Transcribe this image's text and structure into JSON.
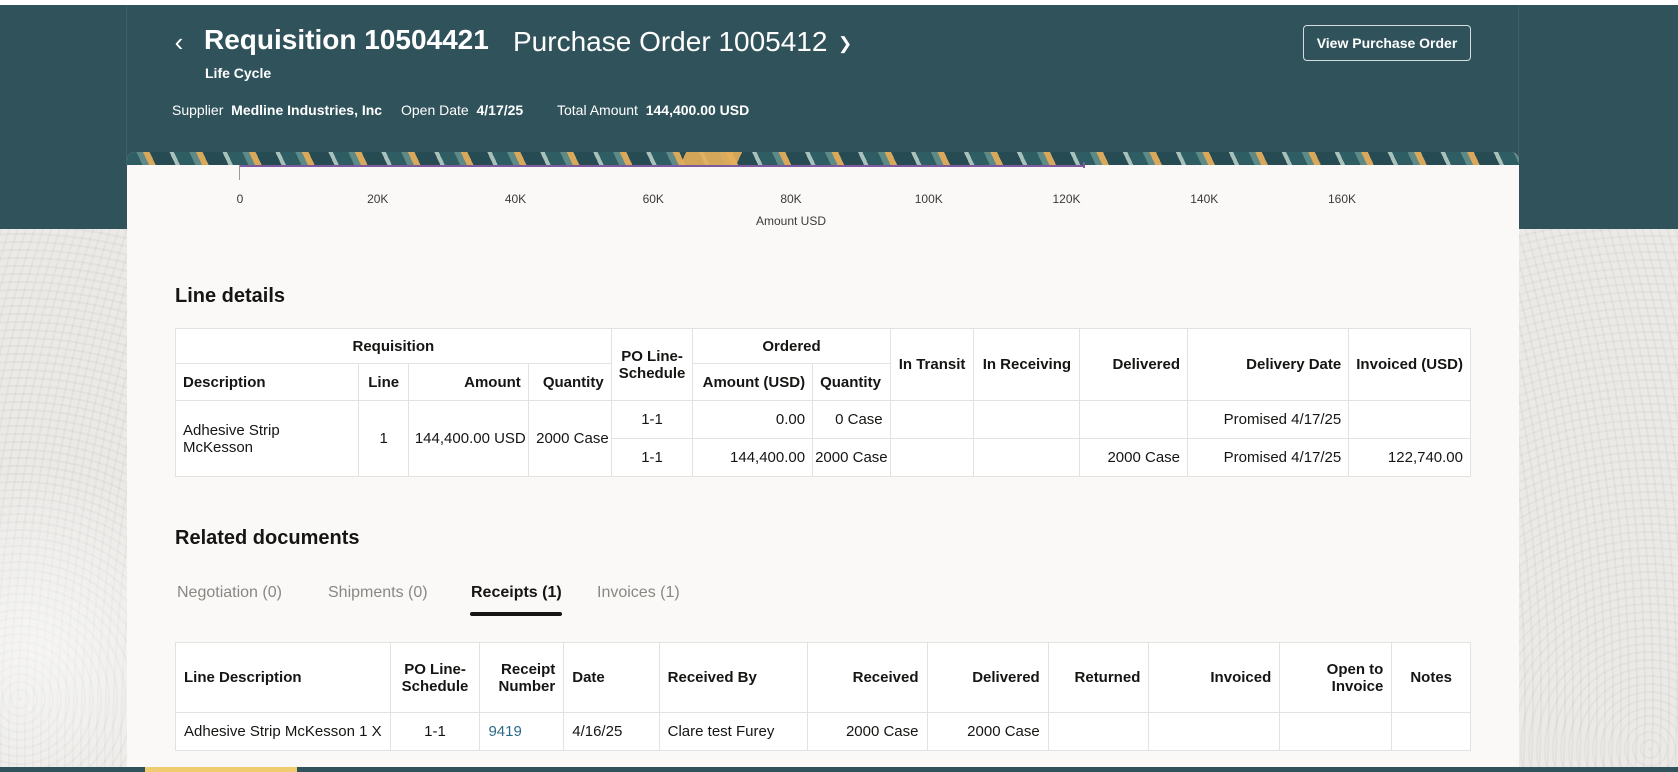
{
  "header": {
    "back_icon": "chevron-left-icon",
    "title": "Requisition 10504421",
    "subtitle": "Purchase Order 1005412",
    "dropdown_icon": "chevron-down-icon",
    "lifecycle": "Life Cycle",
    "supplier_label": "Supplier",
    "supplier_value": "Medline Industries, Inc",
    "open_date_label": "Open Date",
    "open_date_value": "4/17/25",
    "total_amount_label": "Total Amount",
    "total_amount_value": "144,400.00 USD",
    "view_po_button": "View Purchase Order"
  },
  "chart_data": {
    "type": "bar",
    "orientation": "horizontal",
    "xlabel": "Amount USD",
    "tick_labels": [
      "0",
      "20K",
      "40K",
      "60K",
      "80K",
      "100K",
      "120K",
      "140K",
      "160K"
    ],
    "xlim": [
      0,
      160000
    ],
    "series": [
      {
        "values": [
          122740
        ]
      }
    ]
  },
  "line_details": {
    "title": "Line details",
    "group_headers": {
      "requisition": "Requisition",
      "po_line_schedule": "PO Line-Schedule",
      "ordered": "Ordered",
      "in_transit": "In Transit",
      "in_receiving": "In Receiving",
      "delivered": "Delivered",
      "delivery_date": "Delivery Date",
      "invoiced": "Invoiced (USD)"
    },
    "sub_headers": {
      "description": "Description",
      "line": "Line",
      "amount": "Amount",
      "quantity": "Quantity",
      "amount_usd": "Amount (USD)",
      "ordered_quantity": "Quantity"
    },
    "req": {
      "description": "Adhesive Strip McKesson",
      "line": "1",
      "amount": "144,400.00 USD",
      "quantity": "2000 Case"
    },
    "rows": [
      {
        "po_line_schedule": "1-1",
        "amount_usd": "0.00",
        "quantity": "0 Case",
        "in_transit": "",
        "in_receiving": "",
        "delivered": "",
        "delivery_date": "Promised 4/17/25",
        "invoiced": ""
      },
      {
        "po_line_schedule": "1-1",
        "amount_usd": "144,400.00",
        "quantity": "2000 Case",
        "in_transit": "",
        "in_receiving": "",
        "delivered": "2000 Case",
        "delivery_date": "Promised 4/17/25",
        "invoiced": "122,740.00"
      }
    ]
  },
  "related": {
    "title": "Related documents",
    "tabs": [
      {
        "label": "Negotiation (0)"
      },
      {
        "label": "Shipments (0)"
      },
      {
        "label": "Receipts (1)"
      },
      {
        "label": "Invoices (1)"
      }
    ],
    "active_tab": "Receipts (1)",
    "columns": {
      "line_description": "Line Description",
      "po_line_schedule": "PO Line-Schedule",
      "receipt_number": "Receipt Number",
      "date": "Date",
      "received_by": "Received By",
      "received": "Received",
      "delivered": "Delivered",
      "returned": "Returned",
      "invoiced": "Invoiced",
      "open_to_invoice": "Open to Invoice",
      "notes": "Notes"
    },
    "rows": [
      {
        "line_description": "Adhesive Strip McKesson 1 X",
        "po_line_schedule": "1-1",
        "receipt_number": "9419",
        "date": "4/16/25",
        "received_by": "Clare test Furey",
        "received": "2000 Case",
        "delivered": "2000 Case",
        "returned": "",
        "invoiced": "",
        "open_to_invoice": "",
        "notes": ""
      }
    ]
  },
  "colors": {
    "header_bg": "#30525a",
    "accent_bar": "#7e5aa0",
    "link": "#2c6b88"
  }
}
